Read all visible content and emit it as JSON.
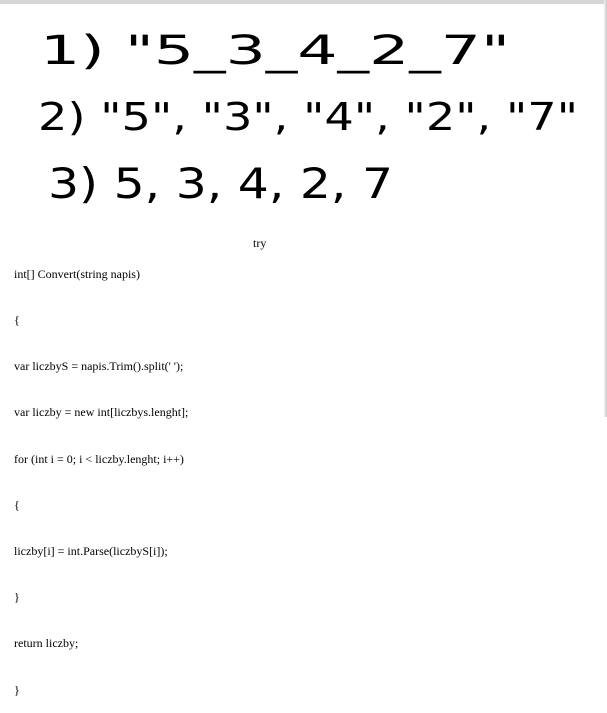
{
  "handwriting": {
    "line1": "1) \"5_3_4_2_7\"",
    "line2": "2) \"5\", \"3\", \"4\", \"2\", \"7\"",
    "line3": "3) 5, 3, 4, 2, 7"
  },
  "code": {
    "lines": [
      "int[] Convert(string napis)",
      "{",
      "var liczbyS = napis.Trim().split(' ');",
      "var liczby = new int[liczbys.lenght];",
      "for (int i = 0; i < liczby.lenght; i++)",
      "{",
      "liczby[i] = int.Parse(liczbyS[i]);",
      "}",
      "return liczby;",
      "}"
    ]
  },
  "side_note": {
    "label": "try"
  }
}
